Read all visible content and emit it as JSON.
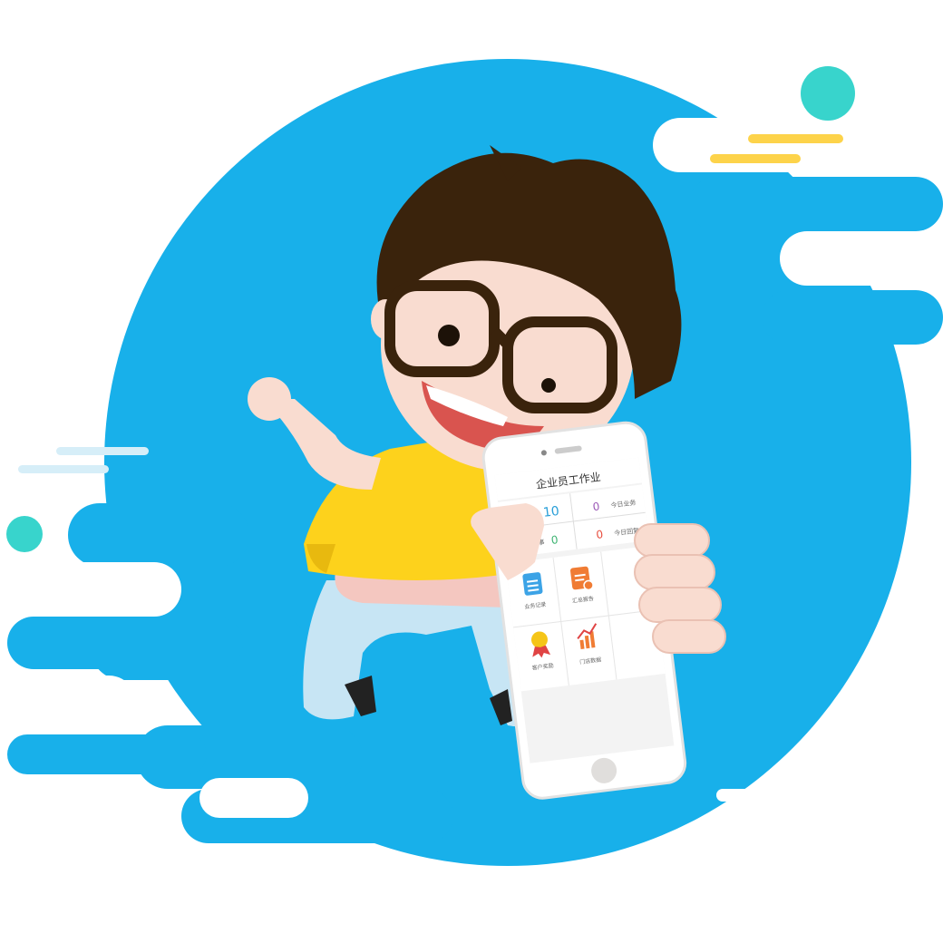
{
  "phone": {
    "title": "企业员工作业",
    "stats": [
      {
        "value": "10",
        "label": ""
      },
      {
        "value": "0",
        "label": "今日业务"
      },
      {
        "value": "0",
        "label": "已办事"
      },
      {
        "value": "0",
        "label": "今日回复"
      }
    ],
    "apps": [
      {
        "label": "业务记录",
        "icon": "notepad-icon"
      },
      {
        "label": "汇总报告",
        "icon": "document-icon"
      },
      {
        "label": "客户奖励",
        "icon": "medal-icon"
      },
      {
        "label": "门店数据",
        "icon": "trend-chart-icon"
      }
    ]
  },
  "colors": {
    "background_circle": "#18b0ea",
    "shirt": "#fdd21c",
    "pants": "#c7e5f4",
    "hair": "#3a230c",
    "skin": "#f9dcd0",
    "accent_teal": "#38d4cc",
    "accent_yellow": "#fdd34a"
  }
}
